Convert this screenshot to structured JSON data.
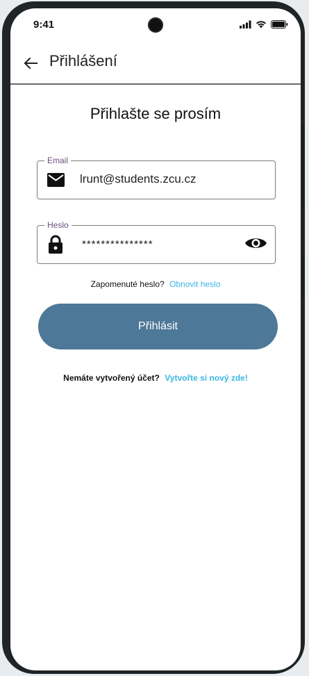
{
  "status_bar": {
    "time": "9:41"
  },
  "app_bar": {
    "title": "Přihlášení"
  },
  "form": {
    "heading": "Přihlašte se prosím",
    "email": {
      "label": "Email",
      "value": "lrunt@students.zcu.cz"
    },
    "password": {
      "label": "Heslo",
      "value": "***************"
    },
    "forgot_text": "Zapomenuté heslo?",
    "forgot_link": "Obnovit heslo",
    "login_button": "Přihlásit",
    "register_text": "Nemáte vytvořený účet?",
    "register_link": "Vytvořte si nový zde!"
  },
  "colors": {
    "primary_button": "#4e7897",
    "link": "#3cb6e3",
    "label": "#6b4e7a"
  },
  "icons": [
    "back-arrow-icon",
    "mail-icon",
    "lock-icon",
    "eye-icon",
    "signal-icon",
    "wifi-icon",
    "battery-icon"
  ]
}
